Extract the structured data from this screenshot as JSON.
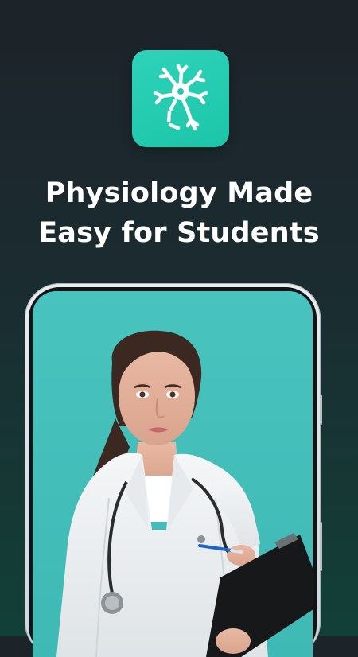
{
  "headline": {
    "line1": "Physiology Made",
    "line2": "Easy for Students"
  },
  "app_icon": {
    "name": "neuron-icon",
    "color": "#22CAAE"
  },
  "colors": {
    "background_top": "#1C2329",
    "background_bottom": "#124038",
    "phone_screen": "#4CC5C0"
  }
}
